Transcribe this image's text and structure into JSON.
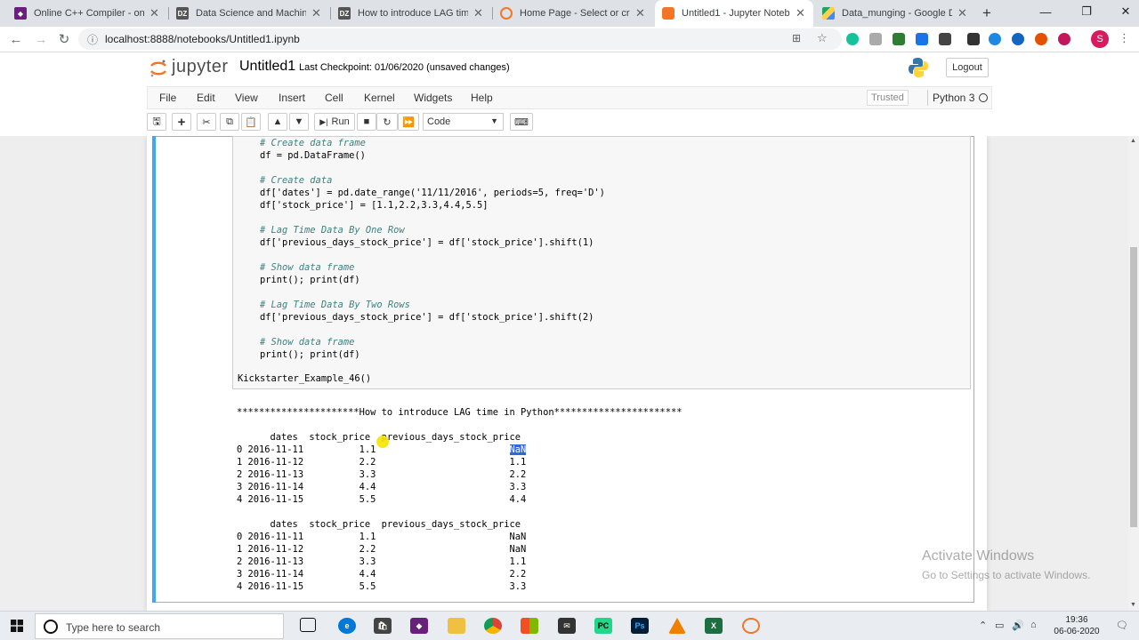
{
  "browser": {
    "tabs": [
      {
        "title": "Online C++ Compiler - online",
        "favicon": "visual-studio",
        "color": "#68217a"
      },
      {
        "title": "Data Science and Machine Le",
        "favicon": "dz",
        "color": "#555"
      },
      {
        "title": "How to introduce LAG time i",
        "favicon": "dz",
        "color": "#555"
      },
      {
        "title": "Home Page - Select or create",
        "favicon": "swirl",
        "color": "#f37626"
      },
      {
        "title": "Untitled1 - Jupyter Noteboo",
        "favicon": "jupyter",
        "color": "#f37626"
      },
      {
        "title": "Data_munging - Google Driv",
        "favicon": "google-drive",
        "color": "#1fa463"
      }
    ],
    "new_tab": "+",
    "url": "localhost:8888/notebooks/Untitled1.ipynb",
    "avatar_letter": "S"
  },
  "jupyter": {
    "logo_text": "jupyter",
    "notebook_name": "Untitled1",
    "checkpoint": "Last Checkpoint: 01/06/2020  (unsaved changes)",
    "logout_label": "Logout",
    "menu": [
      "File",
      "Edit",
      "View",
      "Insert",
      "Cell",
      "Kernel",
      "Widgets",
      "Help"
    ],
    "trusted": "Trusted",
    "kernel": "Python 3",
    "toolbar": {
      "run_label": "Run",
      "cell_type": "Code"
    }
  },
  "code_lines": [
    {
      "type": "comment",
      "text": "# Create data frame"
    },
    {
      "type": "code",
      "text": "df = pd.DataFrame()"
    },
    {
      "type": "blank",
      "text": ""
    },
    {
      "type": "comment",
      "text": "# Create data"
    },
    {
      "type": "code",
      "text": "df['dates'] = pd.date_range('11/11/2016', periods=5, freq='D')"
    },
    {
      "type": "code",
      "text": "df['stock_price'] = [1.1,2.2,3.3,4.4,5.5]"
    },
    {
      "type": "blank",
      "text": ""
    },
    {
      "type": "comment",
      "text": "# Lag Time Data By One Row"
    },
    {
      "type": "code",
      "text": "df['previous_days_stock_price'] = df['stock_price'].shift(1)"
    },
    {
      "type": "blank",
      "text": ""
    },
    {
      "type": "comment",
      "text": "# Show data frame"
    },
    {
      "type": "code",
      "text": "print(); print(df)"
    },
    {
      "type": "blank",
      "text": ""
    },
    {
      "type": "comment",
      "text": "# Lag Time Data By Two Rows"
    },
    {
      "type": "code",
      "text": "df['previous_days_stock_price'] = df['stock_price'].shift(2)"
    },
    {
      "type": "blank",
      "text": ""
    },
    {
      "type": "comment",
      "text": "# Show data frame"
    },
    {
      "type": "code",
      "text": "print(); print(df)"
    }
  ],
  "call_line": "Kickstarter_Example_46()",
  "output": {
    "banner": "**********************How to introduce LAG time in Python***********************",
    "table1": {
      "header": "      dates  stock_price  previous_days_stock_price",
      "rows": [
        "0 2016-11-11          1.1                        NaN",
        "1 2016-11-12          2.2                        1.1",
        "2 2016-11-13          3.3                        2.2",
        "3 2016-11-14          4.4                        3.3",
        "4 2016-11-15          5.5                        4.4"
      ]
    },
    "table2": {
      "header": "      dates  stock_price  previous_days_stock_price",
      "rows": [
        "0 2016-11-11          1.1                        NaN",
        "1 2016-11-12          2.2                        NaN",
        "2 2016-11-13          3.3                        1.1",
        "3 2016-11-14          4.4                        2.2",
        "4 2016-11-15          5.5                        3.3"
      ]
    },
    "selected_text": "NaN"
  },
  "watermark": {
    "line1": "Activate Windows",
    "line2": "Go to Settings to activate Windows."
  },
  "taskbar": {
    "search_placeholder": "Type here to search",
    "time": "19:36",
    "date": "06-06-2020"
  }
}
